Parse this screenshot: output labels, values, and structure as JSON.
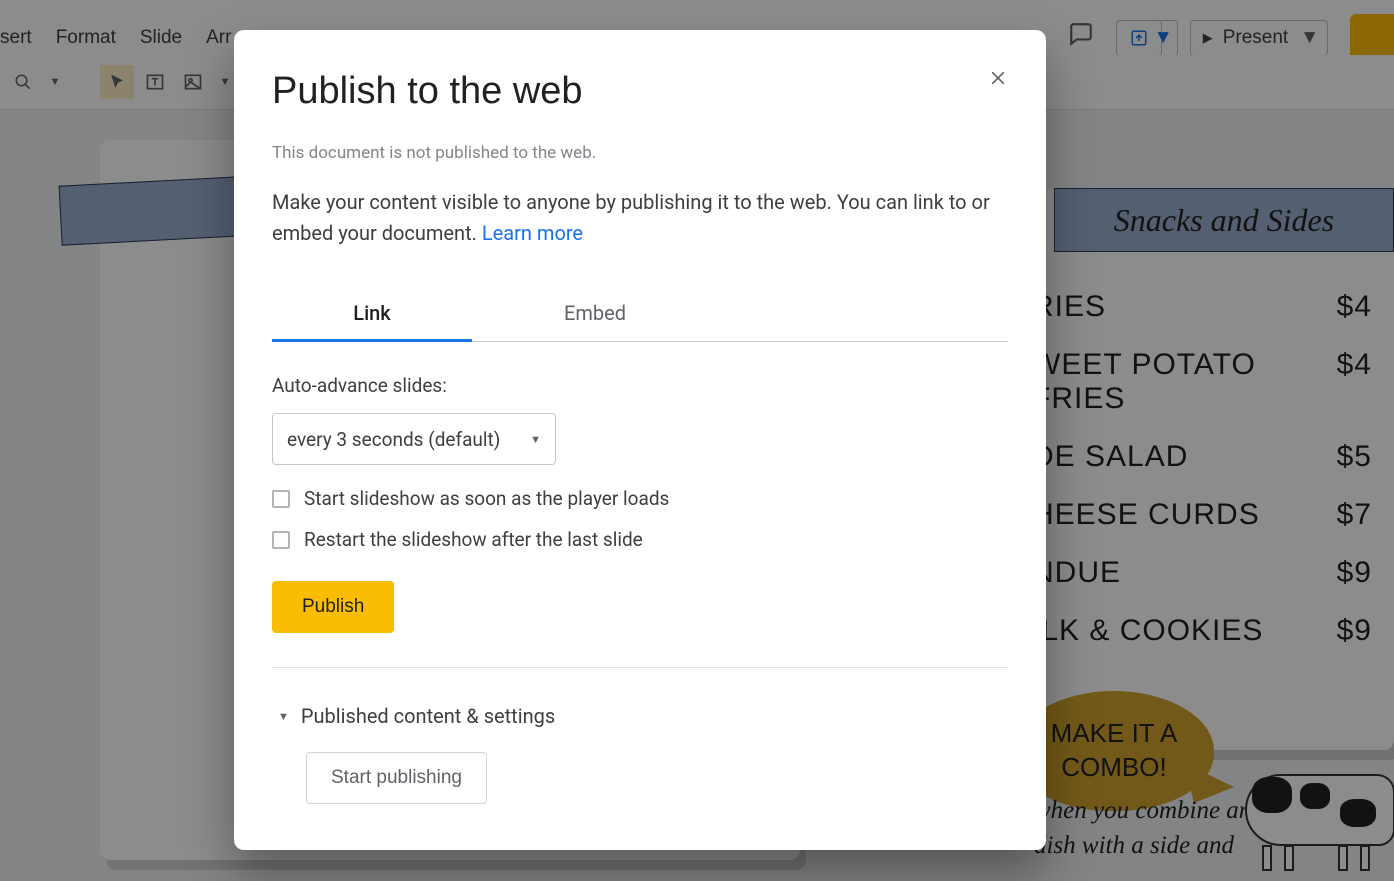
{
  "menubar": {
    "items": [
      "sert",
      "Format",
      "Slide",
      "Arr",
      "",
      "",
      "",
      ""
    ]
  },
  "toolbar_right": {
    "present_label": "Present"
  },
  "modal": {
    "title": "Publish to the web",
    "status": "This document is not published to the web.",
    "description": "Make your content visible to anyone by publishing it to the web. You can link to or embed your document. ",
    "learn_more": "Learn more",
    "tabs": {
      "link": "Link",
      "embed": "Embed"
    },
    "auto_advance_label": "Auto-advance slides:",
    "auto_advance_value": "every 3 seconds (default)",
    "checkbox_start": "Start slideshow as soon as the player loads",
    "checkbox_restart": "Restart the slideshow after the last slide",
    "publish_button": "Publish",
    "published_settings": "Published content & settings",
    "start_publishing": "Start publishing"
  },
  "slide": {
    "banner_right": "Snacks and Sides",
    "menu_items": [
      {
        "name": "RIES",
        "price": "$4"
      },
      {
        "name": "WEET POTATO FRIES",
        "price": "$4"
      },
      {
        "name": "DE SALAD",
        "price": "$5"
      },
      {
        "name": "HEESE CURDS",
        "price": "$7"
      },
      {
        "name": "NDUE",
        "price": "$9"
      },
      {
        "name": "ILK & COOKIES",
        "price": "$9"
      }
    ],
    "combo_line1": "MAKE IT A",
    "combo_line2": "COMBO!",
    "combo_body1": "when you combine any",
    "combo_body2": "dish with a side and"
  }
}
